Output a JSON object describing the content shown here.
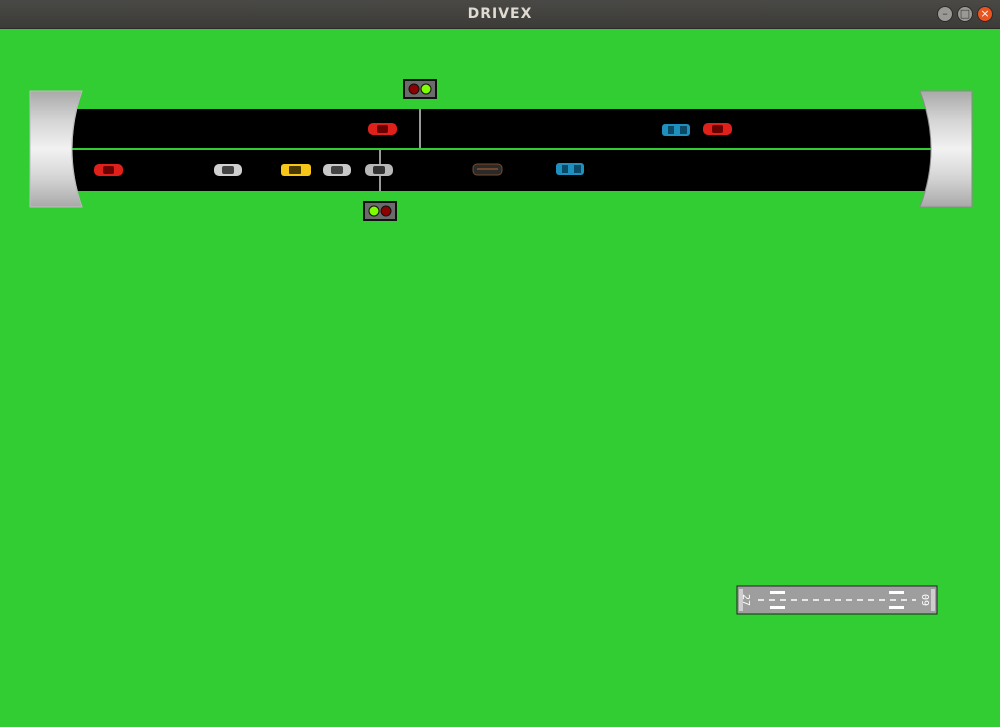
{
  "window": {
    "title": "DRIVEX"
  },
  "colors": {
    "grass": "#32cd32",
    "road": "#000000",
    "lane_line": "#32cd32",
    "light_red": "#8b0000",
    "light_green": "#7fff00"
  },
  "traffic_lights": {
    "top": {
      "states": [
        "red",
        "green"
      ]
    },
    "bottom": {
      "states": [
        "green",
        "red"
      ]
    }
  },
  "runway": {
    "label_left": "27",
    "label_right": "09"
  },
  "cars": [
    {
      "lane": "top",
      "color": "red"
    },
    {
      "lane": "top",
      "color": "blue"
    },
    {
      "lane": "top",
      "color": "red"
    },
    {
      "lane": "bottom",
      "color": "red"
    },
    {
      "lane": "bottom",
      "color": "silver"
    },
    {
      "lane": "bottom",
      "color": "yellow"
    },
    {
      "lane": "bottom",
      "color": "silver"
    },
    {
      "lane": "bottom",
      "color": "silver"
    },
    {
      "lane": "bottom",
      "color": "black"
    },
    {
      "lane": "bottom",
      "color": "blue"
    }
  ]
}
